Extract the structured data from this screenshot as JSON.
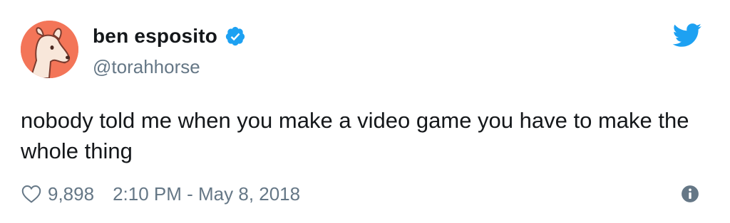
{
  "user": {
    "display_name": "ben esposito",
    "handle": "@torahhorse",
    "verified": true,
    "avatar_bg": "#f37558"
  },
  "tweet": {
    "text": "nobody told me when you make a video game you have to make the whole thing",
    "likes": "9,898",
    "timestamp": "2:10 PM - May 8, 2018"
  },
  "colors": {
    "twitter_blue": "#1da1f2",
    "secondary_text": "#657786",
    "primary_text": "#14171a"
  },
  "icons": {
    "brand": "twitter-bird-icon",
    "verified": "verified-badge-icon",
    "like": "heart-icon",
    "info": "info-icon"
  }
}
